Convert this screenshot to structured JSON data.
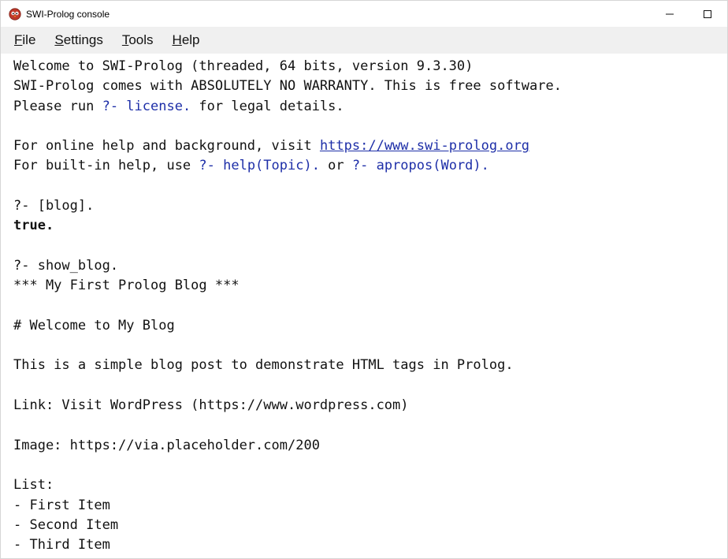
{
  "window": {
    "title": "SWI-Prolog console",
    "icon": "swi-prolog-owl-icon",
    "controls": [
      "minimize",
      "maximize"
    ]
  },
  "menu": {
    "file": {
      "mnemonic": "F",
      "rest": "ile"
    },
    "settings": {
      "mnemonic": "S",
      "rest": "ettings"
    },
    "tools": {
      "mnemonic": "T",
      "rest": "ools"
    },
    "help": {
      "mnemonic": "H",
      "rest": "elp"
    }
  },
  "console": {
    "welcome": "Welcome to SWI-Prolog (threaded, 64 bits, version 9.3.30)",
    "warranty": "SWI-Prolog comes with ABSOLUTELY NO WARRANTY. This is free software.",
    "license": {
      "pre": "Please run ",
      "query": "?- license.",
      "post": " for legal details."
    },
    "online_help": {
      "pre": "For online help and background, visit ",
      "url": "https://www.swi-prolog.org"
    },
    "builtin_help": {
      "pre": "For built-in help, use ",
      "q1": "?- help(Topic).",
      "mid": " or ",
      "q2": "?- apropos(Word)."
    },
    "query1": "?- [blog].",
    "result1": "true.",
    "query2": "?- show_blog.",
    "out_title": "*** My First Prolog Blog ***",
    "out_heading": "# Welcome to My Blog",
    "out_para": "This is a simple blog post to demonstrate HTML tags in Prolog.",
    "out_link": "Link: Visit WordPress (https://www.wordpress.com)",
    "out_image": "Image: https://via.placeholder.com/200",
    "out_list_label": "List:",
    "out_list_items": [
      "- First Item",
      "- Second Item",
      "- Third Item"
    ]
  },
  "colors": {
    "query_blue": "#1e2fa8",
    "menubar_bg": "#f0f0f0"
  }
}
